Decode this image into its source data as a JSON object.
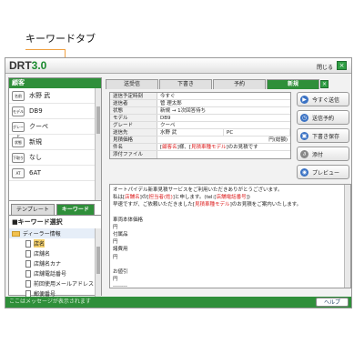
{
  "callout": "キーワードタブ",
  "app": {
    "logo_text": "DRT",
    "logo_version": "3.0",
    "close_label": "閉じる",
    "close_icon": "×"
  },
  "customer": {
    "header": "顧客",
    "rows": [
      {
        "tag": "名前",
        "value": "水野 武"
      },
      {
        "tag": "モデル",
        "value": "DB9"
      },
      {
        "tag": "グレード",
        "value": "クーペ"
      },
      {
        "tag": "状態",
        "value": "新規"
      },
      {
        "tag": "下取り",
        "value": "なし"
      },
      {
        "tag": "AT",
        "value": "6AT"
      }
    ]
  },
  "left_tabs": [
    "テンプレート",
    "キーワード"
  ],
  "keyword": {
    "title": "■キーワード選択",
    "root": "ディーラー情報",
    "items": [
      "店名",
      "店舗名",
      "店舗名カナ",
      "店舗電話番号",
      "前回使用メールアドレス",
      "郵便番号"
    ]
  },
  "right_tabs": [
    "送受信",
    "下書き",
    "予約",
    "新規"
  ],
  "right_tab_close": "×",
  "form": {
    "rows": [
      {
        "label": "送信予定時刻",
        "value": "今すぐ"
      },
      {
        "label": "送信者",
        "value": "管 理太郎"
      },
      {
        "label": "状態",
        "value": "新規 → 1次回答待ち"
      },
      {
        "label": "モデル",
        "value": "DB9"
      },
      {
        "label": "グレード",
        "value": "クーペ"
      }
    ],
    "dest_label": "送信先",
    "dest_name": "水野 武",
    "dest_type": "PC",
    "estimate_label": "見積価格",
    "estimate_value": "円(総額)",
    "subject_label": "件名",
    "subject_pre": "[",
    "subject_red1": "顧客名",
    "subject_mid": "]様、[",
    "subject_red2": "見積車種モデル",
    "subject_post": "]のお見積です",
    "attach_label": "添付ファイル"
  },
  "actions": [
    {
      "label": "今すぐ送信",
      "icon": "send-icon"
    },
    {
      "label": "送信予約",
      "icon": "clock-icon"
    },
    {
      "label": "下書き保存",
      "icon": "save-icon"
    },
    {
      "label": "添付",
      "icon": "paperclip-icon"
    },
    {
      "label": "プレビュー",
      "icon": "preview-icon"
    }
  ],
  "body": {
    "line1": "オートパイデル新車見積サービスをご利用いただきありがとうございます。",
    "line2_pre": "私は[",
    "line2_red1": "店舗名",
    "line2_mid1": "]の[",
    "line2_red2": "担当者(姓)",
    "line2_mid2": "]と申します。(tel:[",
    "line2_red3": "店舗電話番号",
    "line2_post": "])",
    "line3_pre": "早速ですが、ご依頼いただきました[",
    "line3_red": "見積車種モデル",
    "line3_post": "]のお見積をご案内いたします。",
    "lines_after": [
      "",
      "車両本体価格",
      "円",
      "付属品",
      "円",
      "諸費用",
      "円",
      "",
      "お値引",
      "円",
      "--------"
    ]
  },
  "status": {
    "message": "ここはメッセージが表示されます",
    "help": "ヘルプ"
  }
}
